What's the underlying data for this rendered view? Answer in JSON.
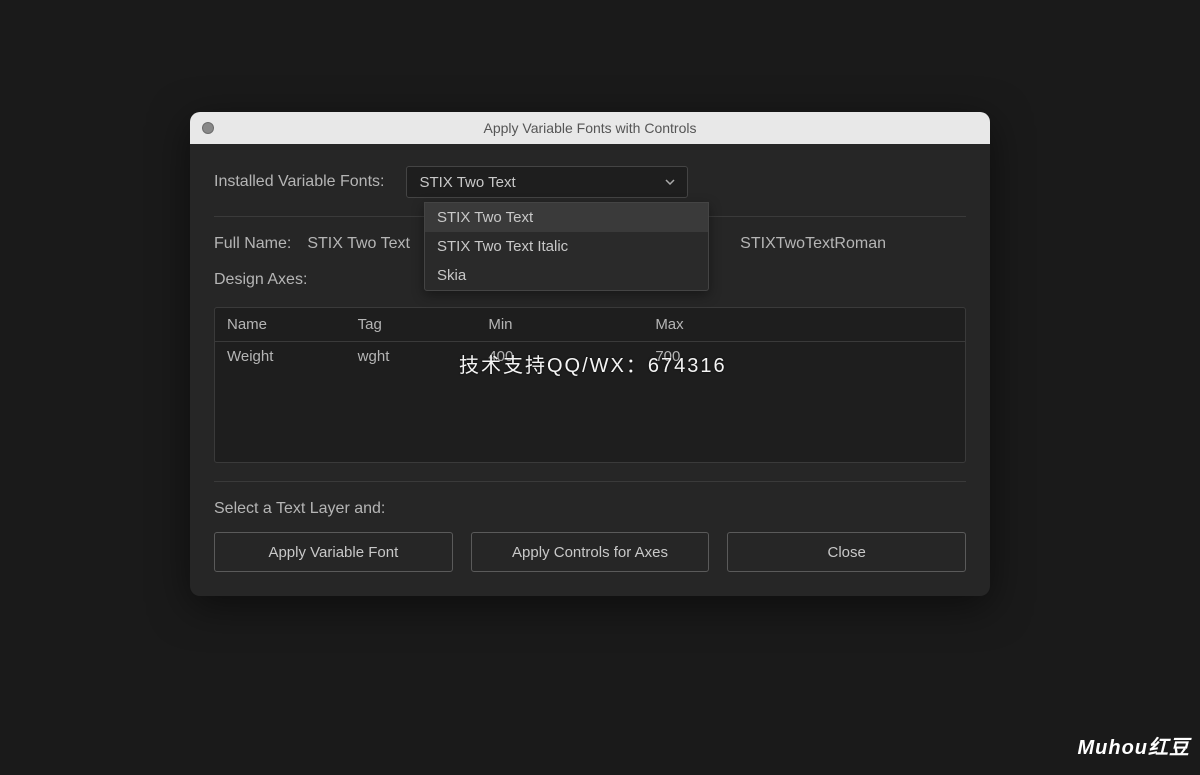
{
  "window": {
    "title": "Apply Variable Fonts with Controls"
  },
  "fontSelector": {
    "label": "Installed Variable Fonts:",
    "selected": "STIX Two Text",
    "options": [
      "STIX Two Text",
      "STIX Two Text Italic",
      "Skia"
    ]
  },
  "fullName": {
    "label": "Full Name:",
    "value": "STIX Two Text"
  },
  "postscriptName": {
    "value": "STIXTwoTextRoman"
  },
  "designAxes": {
    "label": "Design Axes:"
  },
  "table": {
    "headers": {
      "name": "Name",
      "tag": "Tag",
      "min": "Min",
      "max": "Max"
    },
    "rows": [
      {
        "name": "Weight",
        "tag": "wght",
        "min": "400",
        "max": "700"
      }
    ]
  },
  "instruction": "Select a Text Layer and:",
  "buttons": {
    "applyFont": "Apply Variable Font",
    "applyControls": "Apply Controls for Axes",
    "close": "Close"
  },
  "overlay": "技术支持QQ/WX：674316",
  "watermark": "Muhou红豆"
}
